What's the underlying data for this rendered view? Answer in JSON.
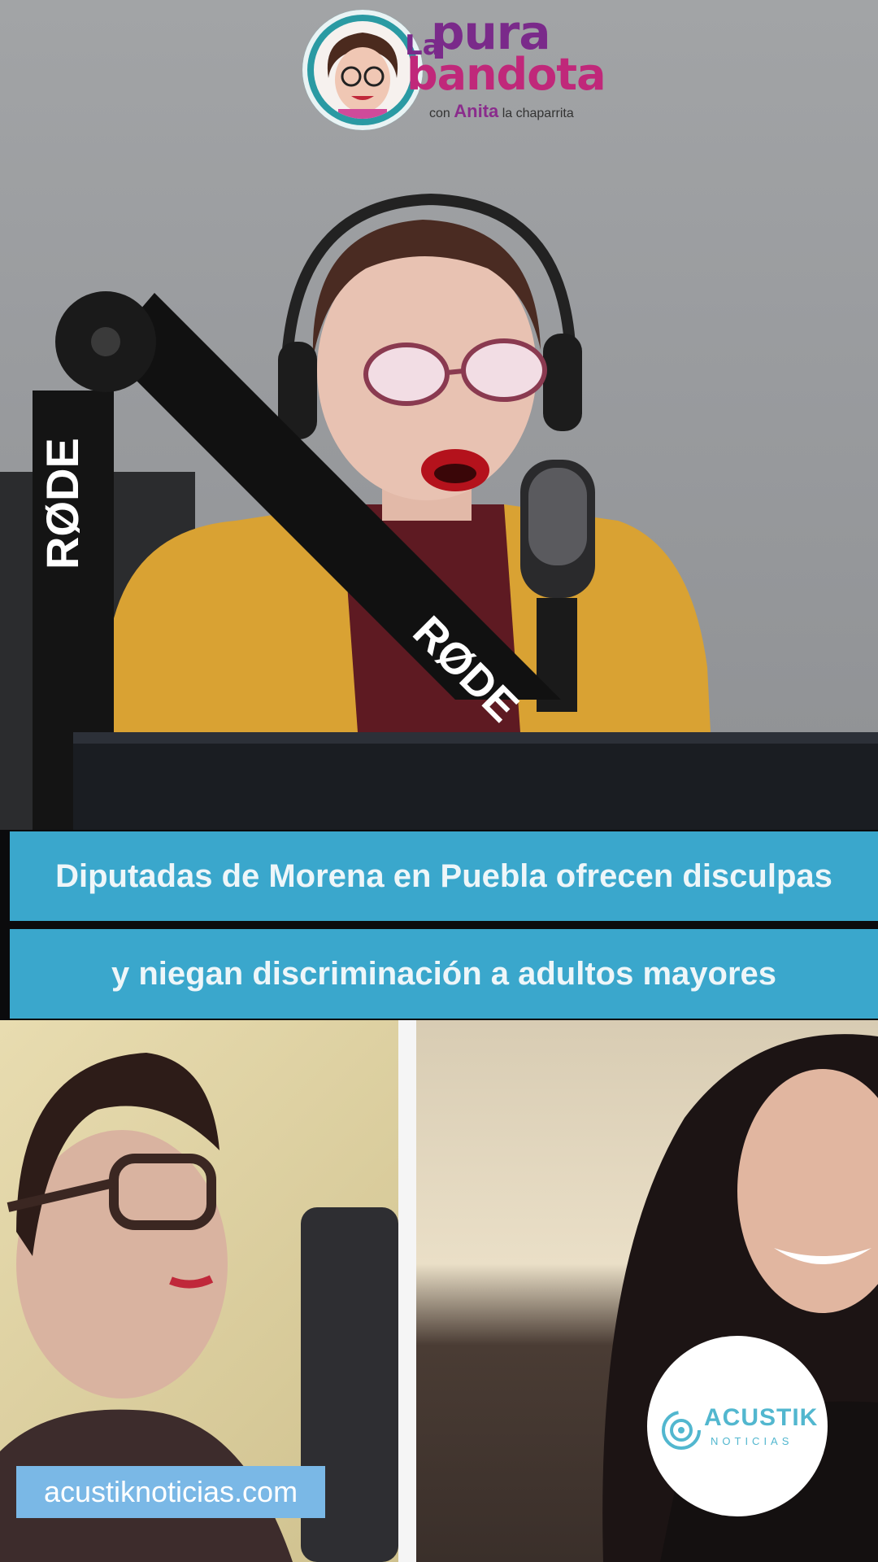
{
  "logo": {
    "la": "La",
    "pura": "pura",
    "bandota": "bandota",
    "con": "con",
    "host": "Anita",
    "host_suffix": "la chaparrita"
  },
  "mic_brand": "RØDE",
  "headline": {
    "line1": "Diputadas de Morena en Puebla ofrecen disculpas",
    "line2": "y niegan discriminación a adultos mayores"
  },
  "website": "acustiknoticias.com",
  "badge": {
    "name": "ACUSTIK",
    "sub": "NOTICIAS"
  },
  "colors": {
    "caption_bar": "#3aa7cc",
    "website_label": "#7ab8e6",
    "logo_purple": "#7a2a8a",
    "logo_magenta": "#c0287a",
    "badge_accent": "#52b7cf"
  }
}
